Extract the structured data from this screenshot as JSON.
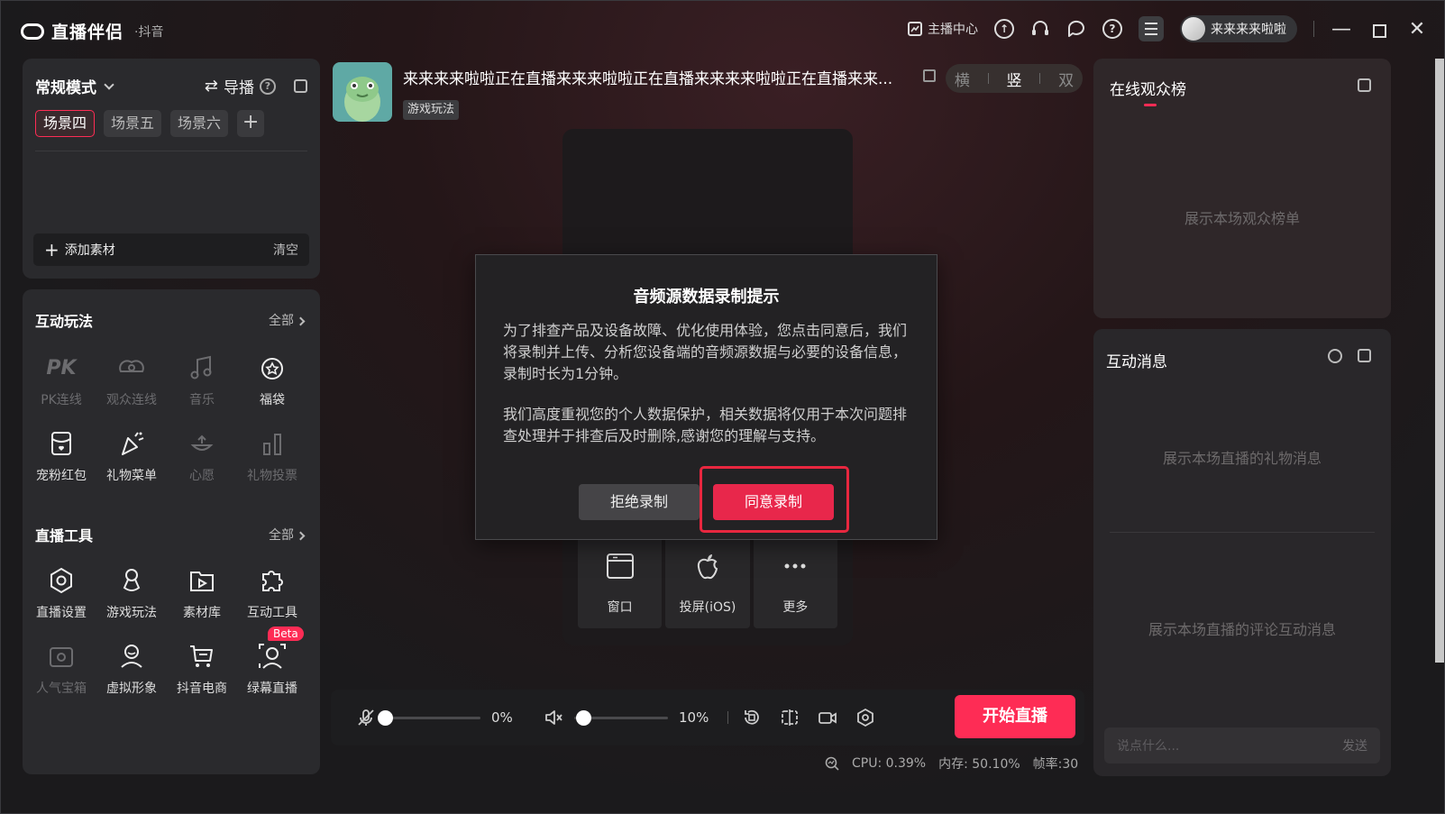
{
  "app": {
    "name": "直播伴侣",
    "platform": "·抖音"
  },
  "titlebar": {
    "anchor_center": "主播中心",
    "user_name": "来来来来啦啦"
  },
  "scene_panel": {
    "mode": "常规模式",
    "director": "导播",
    "tabs": [
      "场景四",
      "场景五",
      "场景六"
    ],
    "add_source": "添加素材",
    "clear": "清空"
  },
  "interactive": {
    "title": "互动玩法",
    "all": "全部",
    "items": [
      {
        "label": "PK连线",
        "icon": "pk-icon",
        "enabled": false
      },
      {
        "label": "观众连线",
        "icon": "audience-link-icon",
        "enabled": false
      },
      {
        "label": "音乐",
        "icon": "music-icon",
        "enabled": false
      },
      {
        "label": "福袋",
        "icon": "lucky-bag-icon",
        "enabled": true
      },
      {
        "label": "宠粉红包",
        "icon": "red-packet-icon",
        "enabled": true
      },
      {
        "label": "礼物菜单",
        "icon": "gift-menu-icon",
        "enabled": true
      },
      {
        "label": "心愿",
        "icon": "wish-icon",
        "enabled": false
      },
      {
        "label": "礼物投票",
        "icon": "gift-vote-icon",
        "enabled": false
      }
    ]
  },
  "live_tools": {
    "title": "直播工具",
    "all": "全部",
    "items": [
      {
        "label": "直播设置",
        "icon": "settings-icon",
        "enabled": true
      },
      {
        "label": "游戏玩法",
        "icon": "game-icon",
        "enabled": true
      },
      {
        "label": "素材库",
        "icon": "media-library-icon",
        "enabled": true
      },
      {
        "label": "互动工具",
        "icon": "puzzle-icon",
        "enabled": true
      },
      {
        "label": "人气宝箱",
        "icon": "treasure-box-icon",
        "enabled": false
      },
      {
        "label": "虚拟形象",
        "icon": "avatar-icon",
        "enabled": true
      },
      {
        "label": "抖音电商",
        "icon": "cart-icon",
        "enabled": true
      },
      {
        "label": "绿幕直播",
        "icon": "green-screen-icon",
        "enabled": true,
        "badge": "Beta"
      }
    ]
  },
  "room": {
    "title": "来来来来啦啦正在直播来来来啦啦正在直播来来来来啦啦正在直播来来...",
    "tag": "游戏玩法",
    "orientation": {
      "landscape": "横",
      "portrait": "竖",
      "dual": "双",
      "selected": "portrait"
    }
  },
  "sources": [
    {
      "label": "窗口",
      "icon": "window-icon"
    },
    {
      "label": "投屏(iOS)",
      "icon": "apple-icon"
    },
    {
      "label": "更多",
      "icon": "more-icon"
    }
  ],
  "controls": {
    "mic_volume": "0%",
    "mic_level": 0,
    "speaker_volume": "10%",
    "speaker_level": 0.1,
    "start_live": "开始直播"
  },
  "stats": {
    "cpu": "CPU: 0.39%",
    "memory": "内存: 50.10%",
    "fps": "帧率:30"
  },
  "rank_panel": {
    "title": "在线观众榜",
    "placeholder": "展示本场观众榜单"
  },
  "msg_panel": {
    "title": "互动消息",
    "gift_placeholder": "展示本场直播的礼物消息",
    "comment_placeholder": "展示本场直播的评论互动消息",
    "input_placeholder": "说点什么...",
    "send": "发送"
  },
  "modal": {
    "title": "音频源数据录制提示",
    "p1": "为了排查产品及设备故障、优化使用体验，您点击同意后，我们将录制并上传、分析您设备端的音频源数据与必要的设备信息，录制时长为1分钟。",
    "p2": "我们高度重视您的个人数据保护，相关数据将仅用于本次问题排查处理并于排查后及时删除,感谢您的理解与支持。",
    "reject": "拒绝录制",
    "agree": "同意录制"
  },
  "colors": {
    "accent": "#fe2c55",
    "highlight_border": "#e8273f"
  }
}
